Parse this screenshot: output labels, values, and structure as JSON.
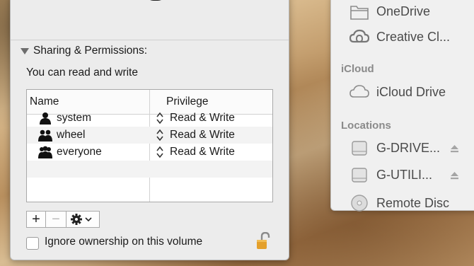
{
  "info": {
    "section_title": "Sharing & Permissions:",
    "access_text": "You can read and write",
    "table": {
      "col_name": "Name",
      "col_privilege": "Privilege",
      "rows": [
        {
          "name": "system",
          "privilege": "Read & Write",
          "icon": "single-user-icon"
        },
        {
          "name": "wheel",
          "privilege": "Read & Write",
          "icon": "group-users-icon"
        },
        {
          "name": "everyone",
          "privilege": "Read & Write",
          "icon": "everyone-users-icon"
        }
      ]
    },
    "buttons": {
      "add": "+",
      "remove": "−",
      "action_icon": "gear-icon"
    },
    "ignore_ownership_label": "Ignore ownership on this volume",
    "ignore_ownership_checked": false,
    "lock_state": "unlocked"
  },
  "sidebar": {
    "top_items": [
      {
        "label": "OneDrive",
        "icon": "folder-icon"
      },
      {
        "label": "Creative Cl...",
        "icon": "creative-cloud-icon"
      }
    ],
    "icloud_header": "iCloud",
    "icloud_items": [
      {
        "label": "iCloud Drive",
        "icon": "cloud-icon"
      }
    ],
    "locations_header": "Locations",
    "location_items": [
      {
        "label": "G-DRIVE...",
        "icon": "drive-icon",
        "eject": true
      },
      {
        "label": "G-UTILI...",
        "icon": "drive-icon",
        "eject": true
      },
      {
        "label": "Remote Disc",
        "icon": "disc-icon",
        "eject": false
      }
    ]
  },
  "colors": {
    "panel_bg": "#ececec",
    "sidebar_bg": "#f0f0f0",
    "lock": "#e4a02b"
  }
}
